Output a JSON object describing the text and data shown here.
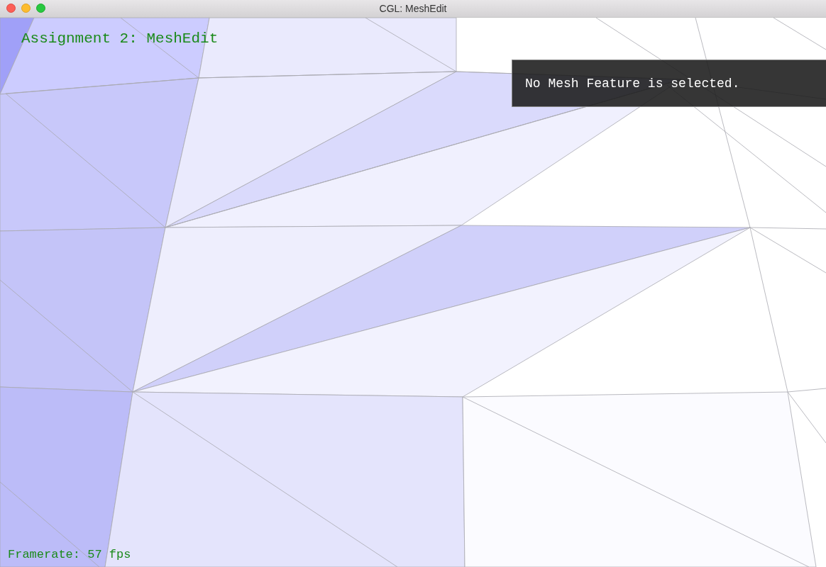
{
  "window": {
    "title": "CGL: MeshEdit"
  },
  "heading": "Assignment 2: MeshEdit",
  "info_panel": {
    "message": "No Mesh Feature is selected."
  },
  "framerate": "Framerate: 57 fps"
}
